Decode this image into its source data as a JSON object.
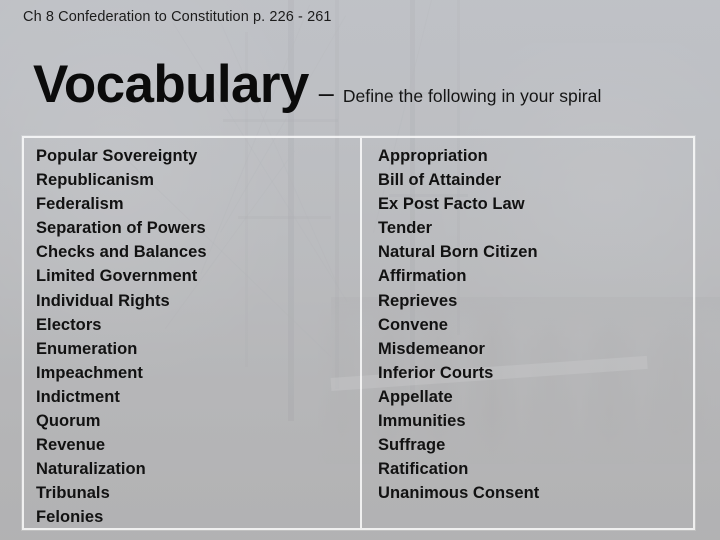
{
  "slide": {
    "kicker": "Ch 8 Confederation to Constitution p. 226 - 261",
    "title": "Vocabulary",
    "title_dash": "–",
    "subtitle": "Define the following in your spiral"
  },
  "colors": {
    "background_top": "#b8bcc2",
    "background_bottom": "#a6a6a6",
    "text": "#121212",
    "title": "#0b0b0b",
    "frame_border": "#ffffff"
  },
  "content": {
    "left_column": [
      "Popular Sovereignty",
      "Republicanism",
      "Federalism",
      "Separation of Powers",
      "Checks and Balances",
      "Limited Government",
      "Individual Rights",
      "Electors",
      "Enumeration",
      "Impeachment",
      "Indictment",
      "Quorum",
      "Revenue",
      "Naturalization",
      "Tribunals",
      "Felonies"
    ],
    "right_column": [
      "Appropriation",
      "Bill of Attainder",
      "Ex Post Facto Law",
      "Tender",
      "Natural Born Citizen",
      "Affirmation",
      "Reprieves",
      "Convene",
      "Misdemeanor",
      "Inferior Courts",
      "Appellate",
      "Immunities",
      "Suffrage",
      "Ratification",
      "Unanimous Consent"
    ]
  }
}
